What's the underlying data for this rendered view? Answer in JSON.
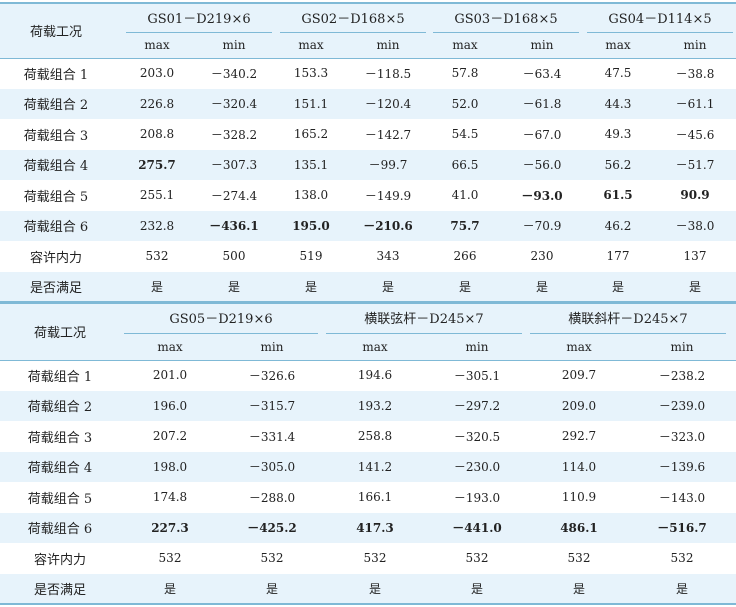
{
  "tables": [
    {
      "corner_label": "荷载工况",
      "groups": [
        {
          "name": "GS01－D219×6",
          "subs": [
            "max",
            "min"
          ]
        },
        {
          "name": "GS02－D168×5",
          "subs": [
            "max",
            "min"
          ]
        },
        {
          "name": "GS03－D168×5",
          "subs": [
            "max",
            "min"
          ]
        },
        {
          "name": "GS04－D114×5",
          "subs": [
            "max",
            "min"
          ]
        }
      ],
      "rows": [
        {
          "label": "荷载组合 1",
          "cells": [
            {
              "v": "203.0"
            },
            {
              "v": "－340.2"
            },
            {
              "v": "153.3"
            },
            {
              "v": "－118.5"
            },
            {
              "v": "57.8"
            },
            {
              "v": "－63.4"
            },
            {
              "v": "47.5"
            },
            {
              "v": "－38.8"
            }
          ]
        },
        {
          "label": "荷载组合 2",
          "cells": [
            {
              "v": "226.8"
            },
            {
              "v": "－320.4"
            },
            {
              "v": "151.1"
            },
            {
              "v": "－120.4"
            },
            {
              "v": "52.0"
            },
            {
              "v": "－61.8"
            },
            {
              "v": "44.3"
            },
            {
              "v": "－61.1"
            }
          ]
        },
        {
          "label": "荷载组合 3",
          "cells": [
            {
              "v": "208.8"
            },
            {
              "v": "－328.2"
            },
            {
              "v": "165.2"
            },
            {
              "v": "－142.7"
            },
            {
              "v": "54.5"
            },
            {
              "v": "－67.0"
            },
            {
              "v": "49.3"
            },
            {
              "v": "－45.6"
            }
          ]
        },
        {
          "label": "荷载组合 4",
          "cells": [
            {
              "v": "275.7",
              "b": true
            },
            {
              "v": "－307.3"
            },
            {
              "v": "135.1"
            },
            {
              "v": "－99.7"
            },
            {
              "v": "66.5"
            },
            {
              "v": "－56.0"
            },
            {
              "v": "56.2"
            },
            {
              "v": "－51.7"
            }
          ]
        },
        {
          "label": "荷载组合 5",
          "cells": [
            {
              "v": "255.1"
            },
            {
              "v": "－274.4"
            },
            {
              "v": "138.0"
            },
            {
              "v": "－149.9"
            },
            {
              "v": "41.0"
            },
            {
              "v": "－93.0",
              "b": true
            },
            {
              "v": "61.5",
              "b": true
            },
            {
              "v": "90.9",
              "b": true
            }
          ]
        },
        {
          "label": "荷载组合 6",
          "cells": [
            {
              "v": "232.8"
            },
            {
              "v": "－436.1",
              "b": true
            },
            {
              "v": "195.0",
              "b": true
            },
            {
              "v": "－210.6",
              "b": true
            },
            {
              "v": "75.7",
              "b": true
            },
            {
              "v": "－70.9"
            },
            {
              "v": "46.2"
            },
            {
              "v": "－38.0"
            }
          ]
        },
        {
          "label": "容许内力",
          "cells": [
            {
              "v": "532"
            },
            {
              "v": "500"
            },
            {
              "v": "519"
            },
            {
              "v": "343"
            },
            {
              "v": "266"
            },
            {
              "v": "230"
            },
            {
              "v": "177"
            },
            {
              "v": "137"
            }
          ]
        },
        {
          "label": "是否满足",
          "cells": [
            {
              "v": "是"
            },
            {
              "v": "是"
            },
            {
              "v": "是"
            },
            {
              "v": "是"
            },
            {
              "v": "是"
            },
            {
              "v": "是"
            },
            {
              "v": "是"
            },
            {
              "v": "是"
            }
          ]
        }
      ]
    },
    {
      "corner_label": "荷载工况",
      "groups": [
        {
          "name": "GS05－D219×6",
          "subs": [
            "max",
            "min"
          ]
        },
        {
          "name": "横联弦杆－D245×7",
          "subs": [
            "max",
            "min"
          ]
        },
        {
          "name": "横联斜杆－D245×7",
          "subs": [
            "max",
            "min"
          ]
        }
      ],
      "rows": [
        {
          "label": "荷载组合 1",
          "cells": [
            {
              "v": "201.0"
            },
            {
              "v": "－326.6"
            },
            {
              "v": "194.6"
            },
            {
              "v": "－305.1"
            },
            {
              "v": "209.7"
            },
            {
              "v": "－238.2"
            }
          ]
        },
        {
          "label": "荷载组合 2",
          "cells": [
            {
              "v": "196.0"
            },
            {
              "v": "－315.7"
            },
            {
              "v": "193.2"
            },
            {
              "v": "－297.2"
            },
            {
              "v": "209.0"
            },
            {
              "v": "－239.0"
            }
          ]
        },
        {
          "label": "荷载组合 3",
          "cells": [
            {
              "v": "207.2"
            },
            {
              "v": "－331.4"
            },
            {
              "v": "258.8"
            },
            {
              "v": "－320.5"
            },
            {
              "v": "292.7"
            },
            {
              "v": "－323.0"
            }
          ]
        },
        {
          "label": "荷载组合 4",
          "cells": [
            {
              "v": "198.0"
            },
            {
              "v": "－305.0"
            },
            {
              "v": "141.2"
            },
            {
              "v": "－230.0"
            },
            {
              "v": "114.0"
            },
            {
              "v": "－139.6"
            }
          ]
        },
        {
          "label": "荷载组合 5",
          "cells": [
            {
              "v": "174.8"
            },
            {
              "v": "－288.0"
            },
            {
              "v": "166.1"
            },
            {
              "v": "－193.0"
            },
            {
              "v": "110.9"
            },
            {
              "v": "－143.0"
            }
          ]
        },
        {
          "label": "荷载组合 6",
          "cells": [
            {
              "v": "227.3",
              "b": true
            },
            {
              "v": "－425.2",
              "b": true
            },
            {
              "v": "417.3",
              "b": true
            },
            {
              "v": "－441.0",
              "b": true
            },
            {
              "v": "486.1",
              "b": true
            },
            {
              "v": "－516.7",
              "b": true
            }
          ]
        },
        {
          "label": "容许内力",
          "cells": [
            {
              "v": "532"
            },
            {
              "v": "532"
            },
            {
              "v": "532"
            },
            {
              "v": "532"
            },
            {
              "v": "532"
            },
            {
              "v": "532"
            }
          ]
        },
        {
          "label": "是否满足",
          "cells": [
            {
              "v": "是"
            },
            {
              "v": "是"
            },
            {
              "v": "是"
            },
            {
              "v": "是"
            },
            {
              "v": "是"
            },
            {
              "v": "是"
            }
          ]
        }
      ]
    }
  ],
  "colors": {
    "row_shade": "#e7f3fb",
    "rule": "#7fb9d6"
  }
}
